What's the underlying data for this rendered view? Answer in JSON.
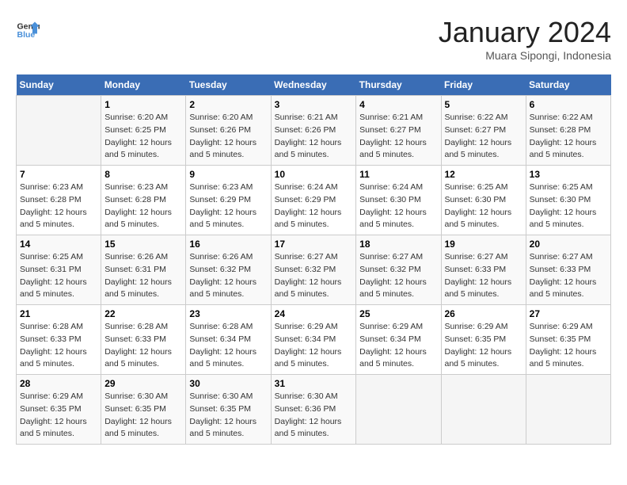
{
  "header": {
    "logo_line1": "General",
    "logo_line2": "Blue",
    "month_title": "January 2024",
    "subtitle": "Muara Sipongi, Indonesia"
  },
  "days_of_week": [
    "Sunday",
    "Monday",
    "Tuesday",
    "Wednesday",
    "Thursday",
    "Friday",
    "Saturday"
  ],
  "weeks": [
    [
      {
        "day": "",
        "info": ""
      },
      {
        "day": "1",
        "info": "Sunrise: 6:20 AM\nSunset: 6:25 PM\nDaylight: 12 hours\nand 5 minutes."
      },
      {
        "day": "2",
        "info": "Sunrise: 6:20 AM\nSunset: 6:26 PM\nDaylight: 12 hours\nand 5 minutes."
      },
      {
        "day": "3",
        "info": "Sunrise: 6:21 AM\nSunset: 6:26 PM\nDaylight: 12 hours\nand 5 minutes."
      },
      {
        "day": "4",
        "info": "Sunrise: 6:21 AM\nSunset: 6:27 PM\nDaylight: 12 hours\nand 5 minutes."
      },
      {
        "day": "5",
        "info": "Sunrise: 6:22 AM\nSunset: 6:27 PM\nDaylight: 12 hours\nand 5 minutes."
      },
      {
        "day": "6",
        "info": "Sunrise: 6:22 AM\nSunset: 6:28 PM\nDaylight: 12 hours\nand 5 minutes."
      }
    ],
    [
      {
        "day": "7",
        "info": "Sunrise: 6:23 AM\nSunset: 6:28 PM\nDaylight: 12 hours\nand 5 minutes."
      },
      {
        "day": "8",
        "info": "Sunrise: 6:23 AM\nSunset: 6:28 PM\nDaylight: 12 hours\nand 5 minutes."
      },
      {
        "day": "9",
        "info": "Sunrise: 6:23 AM\nSunset: 6:29 PM\nDaylight: 12 hours\nand 5 minutes."
      },
      {
        "day": "10",
        "info": "Sunrise: 6:24 AM\nSunset: 6:29 PM\nDaylight: 12 hours\nand 5 minutes."
      },
      {
        "day": "11",
        "info": "Sunrise: 6:24 AM\nSunset: 6:30 PM\nDaylight: 12 hours\nand 5 minutes."
      },
      {
        "day": "12",
        "info": "Sunrise: 6:25 AM\nSunset: 6:30 PM\nDaylight: 12 hours\nand 5 minutes."
      },
      {
        "day": "13",
        "info": "Sunrise: 6:25 AM\nSunset: 6:30 PM\nDaylight: 12 hours\nand 5 minutes."
      }
    ],
    [
      {
        "day": "14",
        "info": "Sunrise: 6:25 AM\nSunset: 6:31 PM\nDaylight: 12 hours\nand 5 minutes."
      },
      {
        "day": "15",
        "info": "Sunrise: 6:26 AM\nSunset: 6:31 PM\nDaylight: 12 hours\nand 5 minutes."
      },
      {
        "day": "16",
        "info": "Sunrise: 6:26 AM\nSunset: 6:32 PM\nDaylight: 12 hours\nand 5 minutes."
      },
      {
        "day": "17",
        "info": "Sunrise: 6:27 AM\nSunset: 6:32 PM\nDaylight: 12 hours\nand 5 minutes."
      },
      {
        "day": "18",
        "info": "Sunrise: 6:27 AM\nSunset: 6:32 PM\nDaylight: 12 hours\nand 5 minutes."
      },
      {
        "day": "19",
        "info": "Sunrise: 6:27 AM\nSunset: 6:33 PM\nDaylight: 12 hours\nand 5 minutes."
      },
      {
        "day": "20",
        "info": "Sunrise: 6:27 AM\nSunset: 6:33 PM\nDaylight: 12 hours\nand 5 minutes."
      }
    ],
    [
      {
        "day": "21",
        "info": "Sunrise: 6:28 AM\nSunset: 6:33 PM\nDaylight: 12 hours\nand 5 minutes."
      },
      {
        "day": "22",
        "info": "Sunrise: 6:28 AM\nSunset: 6:33 PM\nDaylight: 12 hours\nand 5 minutes."
      },
      {
        "day": "23",
        "info": "Sunrise: 6:28 AM\nSunset: 6:34 PM\nDaylight: 12 hours\nand 5 minutes."
      },
      {
        "day": "24",
        "info": "Sunrise: 6:29 AM\nSunset: 6:34 PM\nDaylight: 12 hours\nand 5 minutes."
      },
      {
        "day": "25",
        "info": "Sunrise: 6:29 AM\nSunset: 6:34 PM\nDaylight: 12 hours\nand 5 minutes."
      },
      {
        "day": "26",
        "info": "Sunrise: 6:29 AM\nSunset: 6:35 PM\nDaylight: 12 hours\nand 5 minutes."
      },
      {
        "day": "27",
        "info": "Sunrise: 6:29 AM\nSunset: 6:35 PM\nDaylight: 12 hours\nand 5 minutes."
      }
    ],
    [
      {
        "day": "28",
        "info": "Sunrise: 6:29 AM\nSunset: 6:35 PM\nDaylight: 12 hours\nand 5 minutes."
      },
      {
        "day": "29",
        "info": "Sunrise: 6:30 AM\nSunset: 6:35 PM\nDaylight: 12 hours\nand 5 minutes."
      },
      {
        "day": "30",
        "info": "Sunrise: 6:30 AM\nSunset: 6:35 PM\nDaylight: 12 hours\nand 5 minutes."
      },
      {
        "day": "31",
        "info": "Sunrise: 6:30 AM\nSunset: 6:36 PM\nDaylight: 12 hours\nand 5 minutes."
      },
      {
        "day": "",
        "info": ""
      },
      {
        "day": "",
        "info": ""
      },
      {
        "day": "",
        "info": ""
      }
    ]
  ]
}
